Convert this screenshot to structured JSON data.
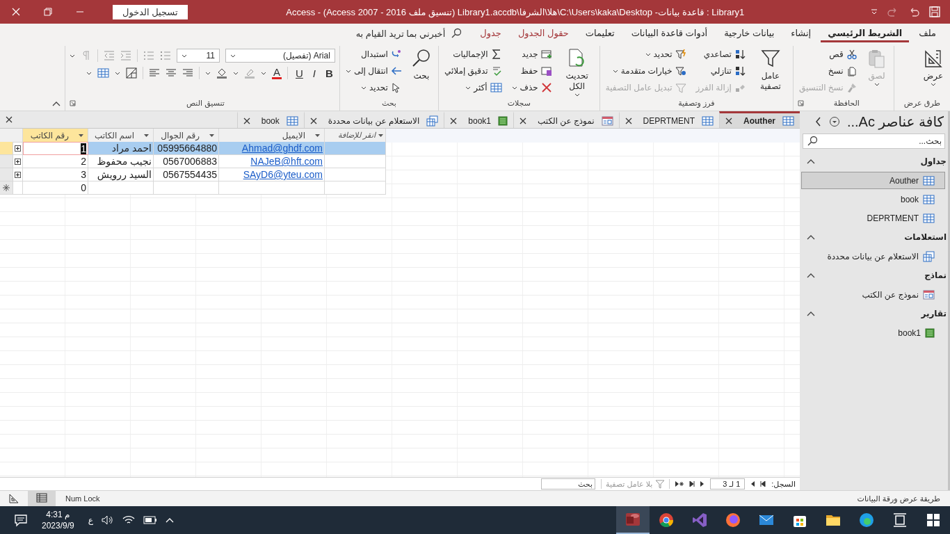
{
  "window": {
    "title": "Library1 : قاعدة بيانات- C:\\Users\\kaka\\Desktop\\هلا\\الشرفا\\Library1.accdb (تنسيق ملف Access 2007 - 2016)  -  Access",
    "sign_in": "تسجيل الدخول"
  },
  "ribbon": {
    "tabs": [
      {
        "label": "ملف",
        "selected": false,
        "contextual": false
      },
      {
        "label": "الشريط الرئيسي",
        "selected": true,
        "contextual": false
      },
      {
        "label": "إنشاء",
        "selected": false,
        "contextual": false
      },
      {
        "label": "بيانات خارجية",
        "selected": false,
        "contextual": false
      },
      {
        "label": "أدوات قاعدة البيانات",
        "selected": false,
        "contextual": false
      },
      {
        "label": "تعليمات",
        "selected": false,
        "contextual": false
      },
      {
        "label": "حقول الجدول",
        "selected": false,
        "contextual": true
      },
      {
        "label": "جدول",
        "selected": false,
        "contextual": true
      }
    ],
    "tell_me": "أخبرني بما تريد القيام به",
    "groups": [
      {
        "title": "طرق عرض",
        "kind": "buttons",
        "dialog_launcher": false,
        "items": [
          {
            "kind": "large",
            "label": "عرض",
            "disabled": false,
            "dropdown": true
          }
        ]
      },
      {
        "title": "الحافظة",
        "kind": "buttons",
        "dialog_launcher": true,
        "items": [
          {
            "kind": "large",
            "label": "لصق",
            "disabled": true,
            "dropdown": true
          },
          {
            "kind": "small",
            "label": "قص",
            "disabled": false,
            "dropdown": false
          },
          {
            "kind": "small",
            "label": "نسخ",
            "disabled": false,
            "dropdown": false
          },
          {
            "kind": "small",
            "label": "نسخ التنسيق",
            "disabled": true,
            "dropdown": false
          }
        ]
      },
      {
        "title": "فرز وتصفية",
        "kind": "buttons",
        "dialog_launcher": false,
        "items": [
          {
            "kind": "large",
            "label": "عامل تصفية",
            "disabled": false,
            "dropdown": false
          },
          {
            "kind": "small",
            "label": "تصاعدي",
            "disabled": false,
            "dropdown": false
          },
          {
            "kind": "small",
            "label": "تنازلي",
            "disabled": false,
            "dropdown": false
          },
          {
            "kind": "small",
            "label": "إزالة الفرز",
            "disabled": true,
            "dropdown": false
          },
          {
            "kind": "small",
            "label": "تحديد",
            "disabled": false,
            "dropdown": true
          },
          {
            "kind": "small",
            "label": "خيارات متقدمة",
            "disabled": false,
            "dropdown": true
          },
          {
            "kind": "small",
            "label": "تبديل عامل التصفية",
            "disabled": true,
            "dropdown": false
          }
        ]
      },
      {
        "title": "سجلات",
        "kind": "buttons",
        "dialog_launcher": false,
        "items": [
          {
            "kind": "large",
            "label": "تحديث الكل",
            "disabled": false,
            "dropdown": true
          },
          {
            "kind": "small",
            "label": "جديد",
            "disabled": false,
            "dropdown": false
          },
          {
            "kind": "small",
            "label": "حفظ",
            "disabled": false,
            "dropdown": false
          },
          {
            "kind": "small",
            "label": "حذف",
            "disabled": false,
            "dropdown": true
          },
          {
            "kind": "small",
            "label": "الإجماليات",
            "disabled": false,
            "dropdown": false
          },
          {
            "kind": "small",
            "label": "تدقيق إملائي",
            "disabled": false,
            "dropdown": false
          },
          {
            "kind": "small",
            "label": "أكثر",
            "disabled": false,
            "dropdown": true
          }
        ]
      },
      {
        "title": "بحث",
        "kind": "buttons",
        "dialog_launcher": false,
        "items": [
          {
            "kind": "large",
            "label": "بحث",
            "disabled": false,
            "dropdown": false
          },
          {
            "kind": "small",
            "label": "استبدال",
            "disabled": false,
            "dropdown": false
          },
          {
            "kind": "small",
            "label": "انتقال إلى",
            "disabled": false,
            "dropdown": true
          },
          {
            "kind": "small",
            "label": "تحديد",
            "disabled": false,
            "dropdown": true
          }
        ]
      },
      {
        "title": "تنسيق النص",
        "kind": "format",
        "dialog_launcher": true,
        "font": "Arial (تفصيل)",
        "size": "11",
        "bold": "B",
        "italic": "I",
        "underline": "U",
        "font_color": "A"
      }
    ]
  },
  "documents": {
    "tabs": [
      {
        "label": "Aouther",
        "kind": "table",
        "selected": true
      },
      {
        "label": "DEPRTMENT",
        "kind": "table",
        "selected": false
      },
      {
        "label": "نموذج عن الكتب",
        "kind": "form",
        "selected": false
      },
      {
        "label": "book1",
        "kind": "report",
        "selected": false
      },
      {
        "label": "الاستعلام عن بيانات محددة",
        "kind": "query",
        "selected": false
      },
      {
        "label": "book",
        "kind": "table",
        "selected": false
      }
    ],
    "datasheet": {
      "add_column": {
        "label": "انقر للإضافة",
        "selected": false
      },
      "columns": [
        {
          "label": "الايميل",
          "kind": "link",
          "selected": false
        },
        {
          "label": "رقم الجوال",
          "kind": "text",
          "selected": false
        },
        {
          "label": "اسم الكاتب",
          "kind": "text",
          "selected": false
        },
        {
          "label": "رقم الكاتب",
          "kind": "number",
          "selected": true
        }
      ],
      "rows": [
        {
          "cells": [
            "Ahmad@ghdf.com",
            "05995664880",
            "احمد مراد",
            "1"
          ],
          "selected": true
        },
        {
          "cells": [
            "NAJeB@hft.com",
            "0567006883",
            "نجيب محفوظ",
            "2"
          ],
          "selected": false
        },
        {
          "cells": [
            "SAyD6@yteu.com",
            "0567554435",
            "السيد ررويش",
            "3"
          ],
          "selected": false
        }
      ],
      "new_row": {
        "default_value": "0"
      }
    },
    "record_nav": {
      "label": "السجل:",
      "position": "1 لـ 3",
      "filter": "بلا عامل تصفية",
      "search": {
        "placeholder": "بحث"
      }
    }
  },
  "nav_pane": {
    "title": "كافة عناصر Ac...",
    "search": {
      "placeholder": "بحث..."
    },
    "groups": [
      {
        "title": "جداول",
        "expanded": true,
        "items": [
          {
            "label": "Aouther",
            "kind": "table",
            "selected": true
          },
          {
            "label": "book",
            "kind": "table",
            "selected": false
          },
          {
            "label": "DEPRTMENT",
            "kind": "table",
            "selected": false
          }
        ]
      },
      {
        "title": "استعلامات",
        "expanded": true,
        "items": [
          {
            "label": "الاستعلام عن بيانات محددة",
            "kind": "query",
            "selected": false
          }
        ]
      },
      {
        "title": "نماذج",
        "expanded": true,
        "items": [
          {
            "label": "نموذج عن الكتب",
            "kind": "form",
            "selected": false
          }
        ]
      },
      {
        "title": "تقارير",
        "expanded": true,
        "items": [
          {
            "label": "book1",
            "kind": "report",
            "selected": false
          }
        ]
      }
    ]
  },
  "status_bar": {
    "view": "طريقة عرض ورقة البيانات",
    "num_lock": "Num Lock"
  },
  "taskbar": {
    "time": "4:31 م",
    "date": "2023/9/9",
    "language": "ع"
  }
}
